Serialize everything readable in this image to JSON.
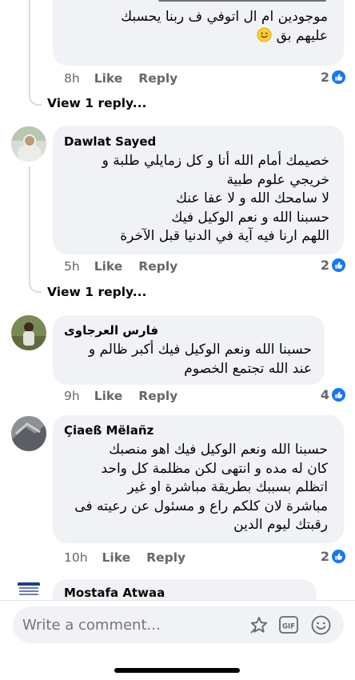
{
  "comments": [
    {
      "id": "c0",
      "author": "",
      "lines": [
        "موجودين ام ال اتوفي ف ربنا يحسبك",
        "عليهم بق"
      ],
      "time": "8h",
      "like_label": "Like",
      "reply_label": "Reply",
      "reaction_count": "2",
      "view_replies": "View 1 reply..."
    },
    {
      "id": "c1",
      "author": "Dawlat Sayed",
      "lines": [
        "خصيمك أمام الله أنا و كل زمايلي طلبة و",
        "خريجي علوم طبية",
        "لا سامحك الله و لا عفا عنك",
        "حسبنا الله و نعم الوكيل فيك",
        "اللهم ارنا فيه آية في الدنيا قبل الآخرة"
      ],
      "time": "5h",
      "like_label": "Like",
      "reply_label": "Reply",
      "reaction_count": "2",
      "view_replies": "View 1 reply..."
    },
    {
      "id": "c2",
      "author": "فارس العرجاوى",
      "lines": [
        "حسبنا الله ونعم الوكيل فيك أكبر ظالم و",
        "عند الله تجتمع الخصوم"
      ],
      "time": "9h",
      "like_label": "Like",
      "reply_label": "Reply",
      "reaction_count": "4"
    },
    {
      "id": "c3",
      "author": "Çiaeß Mëlañz",
      "lines": [
        "حسبنا الله ونعم الوكيل فيك اهو منصبك",
        "كان له مده و انتهى لكن مظلمة كل واحد",
        "اتظلم بسببك بطريقة مباشرة او غير",
        "مباشرة لان كلكم راع و مسئول عن رعيته فى",
        "رقبتك ليوم الدين"
      ],
      "time": "10h",
      "like_label": "Like",
      "reply_label": "Reply",
      "reaction_count": "2"
    },
    {
      "id": "c4",
      "author": "Mostafa Atwaa"
    }
  ],
  "composer": {
    "placeholder": "Write a comment..."
  },
  "colors": {
    "bubble": "#f0f2f5",
    "like_badge": "#1877f2",
    "meta_text": "#65676b"
  },
  "icons": [
    "like-badge-icon",
    "smile-emoji-icon",
    "sticker-icon",
    "gif-icon",
    "emoji-icon"
  ]
}
